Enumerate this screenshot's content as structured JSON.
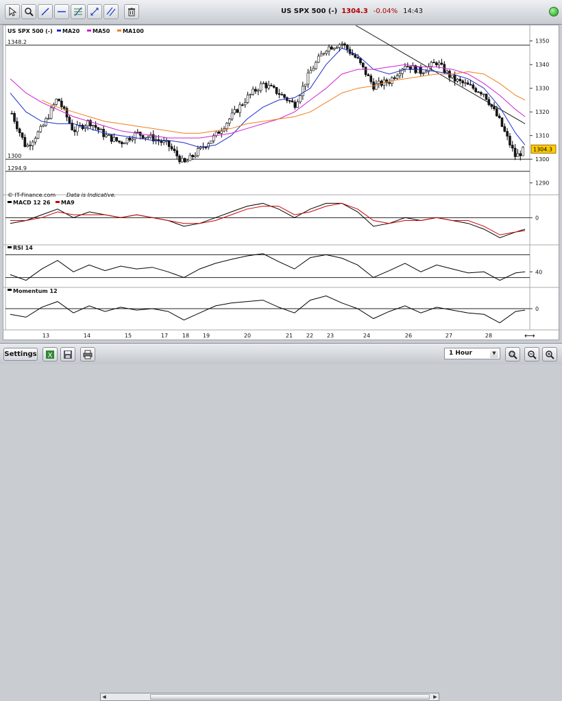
{
  "header": {
    "instrument": "US SPX 500 (-)",
    "price": "1304.3",
    "change": "-0.04%",
    "time": "14:43",
    "tools": [
      "pointer-icon",
      "zoom-icon",
      "trendline-icon",
      "horizontal-line-icon",
      "fibonacci-icon",
      "arrows-icon",
      "parallel-lines-icon",
      "trash-icon"
    ]
  },
  "chart_data": [
    {
      "type": "line",
      "panel": "price",
      "title": "US SPX 500 (-)",
      "legend": [
        "MA20",
        "MA50",
        "MA100"
      ],
      "legend_colors": {
        "MA20": "#1a2ccc",
        "MA50": "#d020d0",
        "MA100": "#f07c1c"
      },
      "x_tick_labels": [
        "13",
        "14",
        "15",
        "17",
        "18",
        "19",
        "20",
        "21",
        "22",
        "23",
        "24",
        "26",
        "27",
        "28"
      ],
      "y_tick_labels": [
        "1350",
        "1340",
        "1330",
        "1320",
        "1310",
        "1300",
        "1290"
      ],
      "ylim": [
        1287,
        1356
      ],
      "current_price_label": "1304.3",
      "horizontal_lines": [
        {
          "label": "1348.2",
          "value": 1348.2
        },
        {
          "label": "1300",
          "value": 1300
        },
        {
          "label": "1294.9",
          "value": 1294.9
        }
      ],
      "trendline": [
        [
          23,
          1360
        ],
        [
          28.8,
          1315
        ]
      ],
      "x": [
        12.5,
        13,
        13.5,
        14,
        14.5,
        15,
        15.5,
        16,
        16.5,
        17,
        17.5,
        18,
        18.5,
        19,
        19.5,
        20,
        20.5,
        21,
        21.5,
        22,
        22.5,
        23,
        23.5,
        24,
        24.5,
        25,
        25.5,
        26,
        26.5,
        27,
        27.5,
        28,
        28.5,
        28.8
      ],
      "series": [
        {
          "name": "Price",
          "values": [
            1321,
            1305,
            1313,
            1326,
            1312,
            1316,
            1310,
            1307,
            1311,
            1309,
            1306,
            1298,
            1304,
            1310,
            1318,
            1326,
            1332,
            1328,
            1323,
            1337,
            1347,
            1349,
            1342,
            1331,
            1333,
            1340,
            1337,
            1341,
            1334,
            1331,
            1328,
            1316,
            1301,
            1304.3
          ]
        },
        {
          "name": "MA20",
          "values": [
            1328,
            1320,
            1316,
            1315,
            1315,
            1313,
            1311,
            1310,
            1309,
            1308,
            1308,
            1307,
            1305,
            1306,
            1310,
            1317,
            1322,
            1325,
            1326,
            1330,
            1340,
            1347,
            1344,
            1338,
            1336,
            1338,
            1338,
            1337,
            1336,
            1334,
            1330,
            1322,
            1311,
            1306
          ]
        },
        {
          "name": "MA50",
          "values": [
            1334,
            1328,
            1324,
            1321,
            1318,
            1316,
            1314,
            1312,
            1311,
            1310,
            1309,
            1309,
            1309,
            1310,
            1311,
            1313,
            1315,
            1317,
            1320,
            1325,
            1330,
            1336,
            1338,
            1338,
            1339,
            1340,
            1339,
            1339,
            1338,
            1336,
            1332,
            1327,
            1321,
            1318
          ]
        },
        {
          "name": "MA100",
          "values": [
            null,
            null,
            1325,
            1322,
            1320,
            1318,
            1316,
            1315,
            1314,
            1313,
            1312,
            1311,
            1311,
            1312,
            1313,
            1315,
            1316,
            1317,
            1318,
            1320,
            1324,
            1328,
            1330,
            1331,
            1333,
            1334,
            1335,
            1336,
            1336,
            1337,
            1336,
            1332,
            1327,
            1325
          ]
        }
      ]
    },
    {
      "type": "line",
      "panel": "macd",
      "title": "MACD 12 26",
      "legend": [
        "MACD 12 26",
        "MA9"
      ],
      "legend_colors": {
        "MACD 12 26": "#000000",
        "MA9": "#cc0000"
      },
      "y_tick_labels": [
        "0"
      ],
      "ylim": [
        -9,
        7
      ],
      "x": [
        12.5,
        13,
        13.5,
        14,
        14.5,
        15,
        15.5,
        16,
        16.5,
        17,
        17.5,
        18,
        18.5,
        19,
        19.5,
        20,
        20.5,
        21,
        21.5,
        22,
        22.5,
        23,
        23.5,
        24,
        24.5,
        25,
        25.5,
        26,
        26.5,
        27,
        27.5,
        28,
        28.5,
        28.8
      ],
      "series": [
        {
          "name": "MACD 12 26",
          "values": [
            -2,
            -1,
            1,
            3,
            0,
            2,
            1,
            0,
            1,
            0,
            -1,
            -3,
            -2,
            0,
            2,
            4,
            5,
            3,
            0,
            3,
            5,
            5,
            2,
            -3,
            -2,
            0,
            -1,
            0,
            -1,
            -2,
            -4,
            -7,
            -5,
            -4
          ]
        },
        {
          "name": "MA9",
          "values": [
            -1,
            -1,
            0,
            2,
            1,
            1,
            1,
            0,
            1,
            0,
            -1,
            -2,
            -2,
            -1,
            1,
            3,
            4,
            4,
            1,
            2,
            4,
            5,
            3,
            -1,
            -2,
            -1,
            -1,
            0,
            -1,
            -1,
            -3,
            -6,
            -5,
            -4.5
          ]
        }
      ]
    },
    {
      "type": "line",
      "panel": "rsi",
      "title": "RSI 14",
      "y_tick_labels": [
        "40"
      ],
      "ylim": [
        15,
        85
      ],
      "reference_lines": [
        70,
        30
      ],
      "x": [
        12.5,
        13,
        13.5,
        14,
        14.5,
        15,
        15.5,
        16,
        16.5,
        17,
        17.5,
        18,
        18.5,
        19,
        19.5,
        20,
        20.5,
        21,
        21.5,
        22,
        22.5,
        23,
        23.5,
        24,
        24.5,
        25,
        25.5,
        26,
        26.5,
        27,
        27.5,
        28,
        28.5,
        28.8
      ],
      "series": [
        {
          "name": "RSI 14",
          "values": [
            35,
            25,
            45,
            60,
            40,
            52,
            42,
            50,
            45,
            48,
            40,
            30,
            45,
            55,
            62,
            68,
            72,
            58,
            45,
            65,
            70,
            64,
            52,
            30,
            42,
            55,
            40,
            52,
            45,
            38,
            40,
            25,
            38,
            40
          ]
        }
      ]
    },
    {
      "type": "line",
      "panel": "momentum",
      "title": "Momentum 12",
      "y_tick_labels": [
        "0"
      ],
      "ylim": [
        -14,
        14
      ],
      "x": [
        12.5,
        13,
        13.5,
        14,
        14.5,
        15,
        15.5,
        16,
        16.5,
        17,
        17.5,
        18,
        18.5,
        19,
        19.5,
        20,
        20.5,
        21,
        21.5,
        22,
        22.5,
        23,
        23.5,
        24,
        24.5,
        25,
        25.5,
        26,
        26.5,
        27,
        27.5,
        28,
        28.5,
        28.8
      ],
      "series": [
        {
          "name": "Momentum 12",
          "values": [
            -4,
            -6,
            1,
            5,
            -3,
            2,
            -2,
            1,
            -1,
            0,
            -2,
            -8,
            -3,
            2,
            4,
            5,
            6,
            1,
            -3,
            6,
            9,
            4,
            0,
            -7,
            -2,
            2,
            -3,
            1,
            -1,
            -3,
            -4,
            -10,
            -2,
            -1
          ]
        }
      ]
    }
  ],
  "footer": {
    "watermark": "© IT-Finance.com",
    "disclaimer": "Data is Indicative."
  },
  "bottombar": {
    "settings_label": "Settings",
    "timeframe": "1 Hour",
    "buttons": [
      "excel-icon",
      "save-icon",
      "print-icon",
      "zoom-select-icon",
      "zoom-out-icon",
      "zoom-in-icon"
    ]
  }
}
